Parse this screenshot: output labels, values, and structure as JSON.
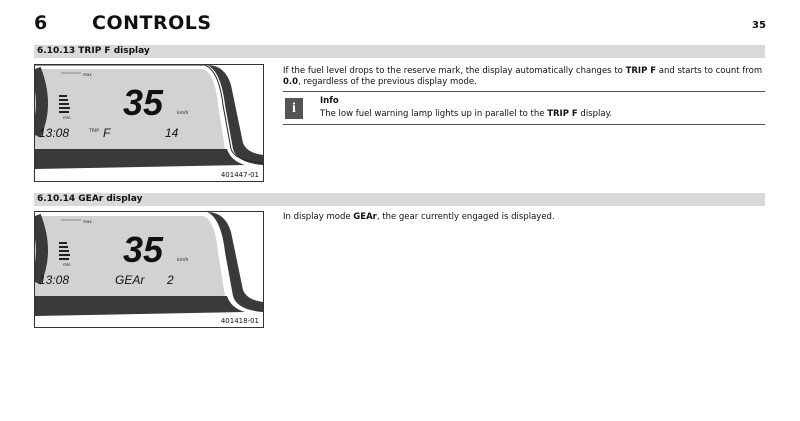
{
  "header": {
    "chapter_number": "6",
    "chapter_title": "CONTROLS",
    "page_number": "35"
  },
  "sections": [
    {
      "number_title": "6.10.13   TRIP F display",
      "figure": {
        "speed": "35",
        "unit": "km/h",
        "max": "max",
        "min": "min",
        "time": "13:08",
        "mode_prefix": "TRIP",
        "mode": "F",
        "value": "14",
        "id": "401447-01"
      },
      "text_parts": [
        "If the fuel level drops to the reserve mark, the display automatically changes to ",
        "TRIP F",
        " and starts to count from ",
        "0.0",
        ", regardless of the previous display mode."
      ],
      "info": {
        "icon": "i",
        "heading": "Info",
        "text_parts": [
          "The low fuel warning lamp lights up in parallel to the ",
          "TRIP F",
          " display."
        ]
      }
    },
    {
      "number_title": "6.10.14   GEAr display",
      "figure": {
        "speed": "35",
        "unit": "km/h",
        "max": "max",
        "min": "min",
        "time": "13:08",
        "mode": "GEAr",
        "value": "2",
        "id": "401418-01"
      },
      "text_parts": [
        "In display mode ",
        "GEAr",
        ", the gear currently engaged is displayed."
      ]
    }
  ]
}
